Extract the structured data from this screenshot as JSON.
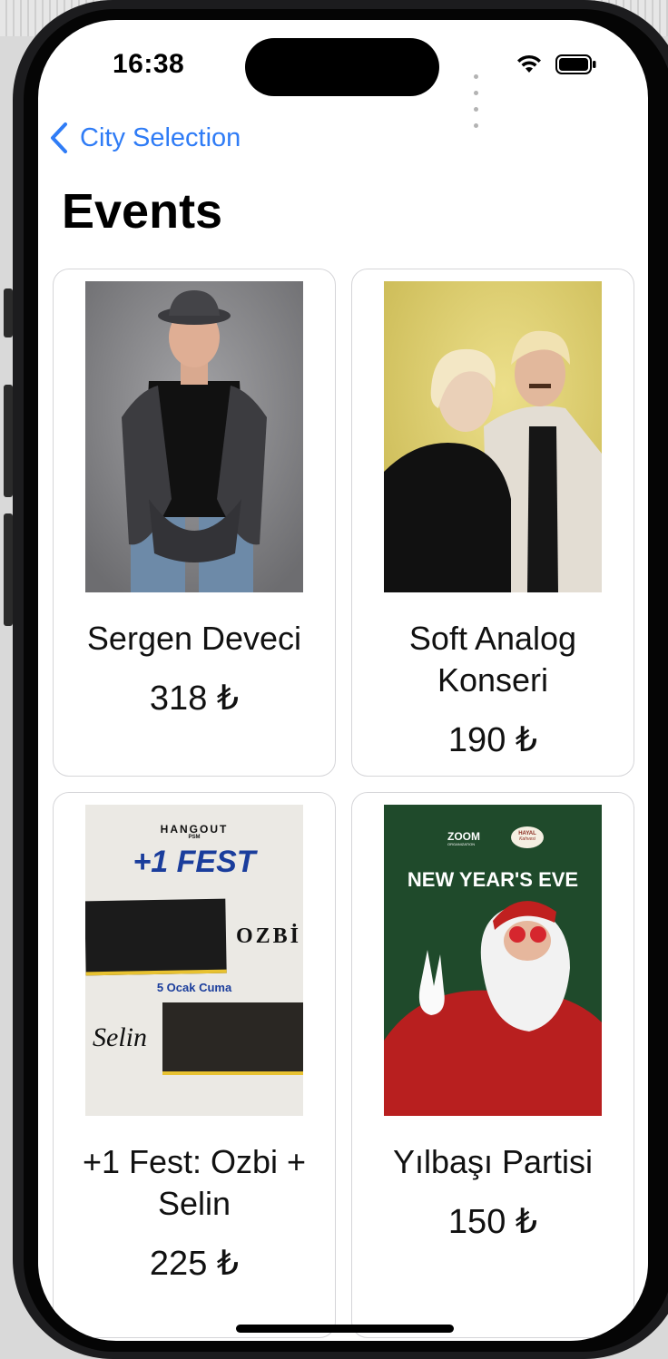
{
  "status_bar": {
    "time": "16:38"
  },
  "nav": {
    "back_label": "City Selection"
  },
  "page": {
    "title": "Events"
  },
  "events": [
    {
      "title": "Sergen Deveci",
      "price": "318 ₺"
    },
    {
      "title": "Soft Analog Konseri",
      "price": "190 ₺"
    },
    {
      "title": "+1 Fest: Ozbi + Selin",
      "price": "225 ₺",
      "poster_text": {
        "venue": "HANGOUT",
        "venue_sub": "PSM",
        "fest": "+1 FEST",
        "artist1": "OZBİ",
        "date": "5 Ocak Cuma",
        "artist2": "Selin"
      }
    },
    {
      "title": "Yılbaşı Partisi",
      "price": "150 ₺",
      "poster_text": {
        "org": "ZOOM",
        "org_sub": "ORGANIZATION",
        "cafe": "HAYAL",
        "cafe_sub": "Kahvesi",
        "headline": "NEW YEAR'S EVE"
      }
    }
  ],
  "colors": {
    "accent": "#2f7cf6",
    "card_border": "#d5d5d8"
  }
}
